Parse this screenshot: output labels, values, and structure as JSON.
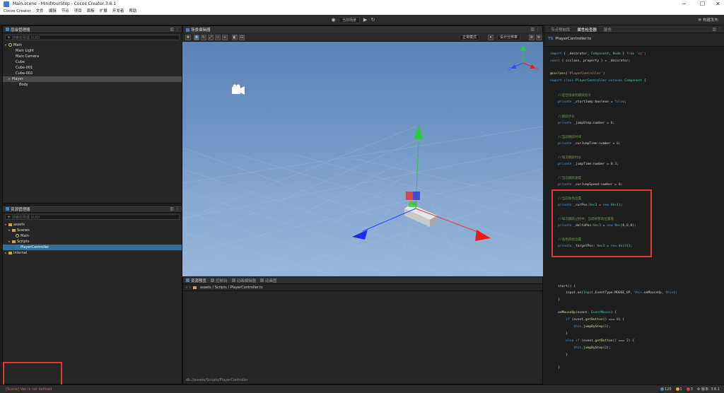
{
  "window": {
    "title": "Main.scene - MindYourStep - Cocos Creator 3.6.1",
    "minimize": "─",
    "maximize": "☐",
    "close": "✕"
  },
  "menu": {
    "items": [
      "Cocos Creator",
      "文件",
      "编辑",
      "节点",
      "项目",
      "面板",
      "扩展",
      "开发者",
      "帮助"
    ]
  },
  "toolbar": {
    "scene_select": "当前场景",
    "right_label": "构建发布"
  },
  "hierarchy": {
    "tab_label": "层级管理器",
    "search_placeholder": "搜索名称或 UUID",
    "nodes": [
      {
        "label": "Main",
        "depth": 0,
        "arrow": "▾",
        "selected": false,
        "kind": "scene"
      },
      {
        "label": "Main Light",
        "depth": 2,
        "arrow": "",
        "selected": false
      },
      {
        "label": "Main Camera",
        "depth": 2,
        "arrow": "",
        "selected": false
      },
      {
        "label": "Cube",
        "depth": 2,
        "arrow": "",
        "selected": false
      },
      {
        "label": "Cube-001",
        "depth": 2,
        "arrow": "",
        "selected": false
      },
      {
        "label": "Cube-002",
        "depth": 2,
        "arrow": "",
        "selected": false
      },
      {
        "label": "Player",
        "depth": 1,
        "arrow": "▾",
        "selected": true
      },
      {
        "label": "Body",
        "depth": 3,
        "arrow": "",
        "selected": false
      }
    ]
  },
  "assets": {
    "tab_label": "资源管理器",
    "search_placeholder": "搜索名称或 UUID",
    "nodes": [
      {
        "label": "assets",
        "depth": 0,
        "arrow": "▾",
        "kind": "folder",
        "selected": false
      },
      {
        "label": "Scenes",
        "depth": 1,
        "arrow": "▾",
        "kind": "folder",
        "selected": false
      },
      {
        "label": "Main",
        "depth": 2,
        "arrow": "",
        "kind": "scene",
        "selected": false
      },
      {
        "label": "Scripts",
        "depth": 1,
        "arrow": "▾",
        "kind": "folder",
        "selected": false
      },
      {
        "label": "PlayerController",
        "depth": 2,
        "arrow": "",
        "kind": "ts",
        "selected": true
      },
      {
        "label": "internal",
        "depth": 0,
        "arrow": "▸",
        "kind": "folder",
        "selected": false
      }
    ]
  },
  "scene": {
    "tab_label": "场景编辑器",
    "view_mode": "正常模式",
    "resolution": "设计分辨率"
  },
  "bottom": {
    "tabs": [
      "资源预览",
      "控制台",
      "动画编辑器",
      "动画图"
    ],
    "path": "assets / Scripts / PlayerController.ts",
    "footer_path": "db://assets/Scripts/PlayerController"
  },
  "inspector": {
    "tabs": [
      "节点预制库",
      "属性检查器",
      "服务"
    ],
    "file_badge": "TS",
    "file_name": "PlayerController.ts"
  },
  "status": {
    "error_message": "[Scene] Vec is not defined",
    "count_info": "120",
    "count_warn": "1",
    "count_error": "3",
    "version": "版本: 3.6.1"
  },
  "colors": {
    "accent": "#3b85c9",
    "highlight": "#e03a3a"
  }
}
